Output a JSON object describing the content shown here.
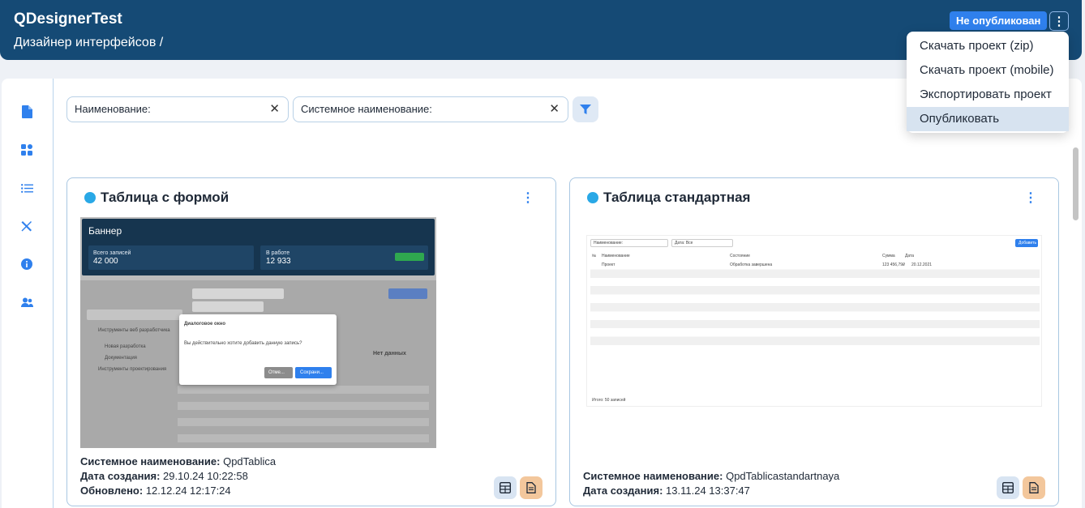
{
  "header": {
    "app_title": "QDesignerTest",
    "breadcrumb": "Дизайнер интерфейсов /",
    "status_badge": "Не опубликован"
  },
  "menu": {
    "items": [
      {
        "label": "Скачать проект (zip)"
      },
      {
        "label": "Скачать проект (mobile)"
      },
      {
        "label": "Экспортировать проект"
      },
      {
        "label": "Опубликовать"
      }
    ]
  },
  "sidebar": {
    "icons": [
      "document-icon",
      "grid-icon",
      "list-icon",
      "tools-icon",
      "info-icon",
      "users-icon"
    ]
  },
  "filters": {
    "name_label": "Наименование:",
    "system_name_label": "Системное наименование:"
  },
  "cards": [
    {
      "title": "Таблица с формой",
      "system_name_label": "Системное наименование:",
      "system_name": "QpdTablica",
      "created_label": "Дата создания:",
      "created": "29.10.24 10:22:58",
      "updated_label": "Обновлено:",
      "updated": "12.12.24 12:17:24",
      "preview": {
        "banner": "Баннер",
        "stat1_label": "Всего записей",
        "stat1_value": "42 000",
        "stat2_label": "В работе",
        "stat2_value": "12 933",
        "dialog_title": "Диалоговое окно",
        "dialog_text": "Вы действительно хотите добавить данную запись?",
        "dialog_cancel": "Отме...",
        "dialog_save": "Сохрани...",
        "tree1": "Инструменты веб разработчика",
        "tree2": "Новая разработка",
        "tree3": "Документация",
        "tree4": "Инструменты проектирования",
        "no_data": "Нет данных"
      }
    },
    {
      "title": "Таблица стандартная",
      "system_name_label": "Системное наименование:",
      "system_name": "QpdTablicastandartnaya",
      "created_label": "Дата создания:",
      "created": "13.11.24 13:37:47",
      "preview": {
        "filter1": "Наименование:",
        "filter2": "Дата: Все",
        "add_button": "Добавить",
        "col1": "№",
        "col2": "Наименование",
        "col3": "Состояние",
        "col4": "Сумма",
        "col5": "Дата",
        "row_name": "Проект",
        "row_state": "Обработка завершена",
        "row_sum": "123 456,79₽",
        "row_date": "20.12.2021",
        "footer": "Итого: 50 записей"
      }
    }
  ],
  "colors": {
    "header_bg": "#154a75",
    "accent": "#2f80ed",
    "status_dot": "#29a8e6"
  }
}
